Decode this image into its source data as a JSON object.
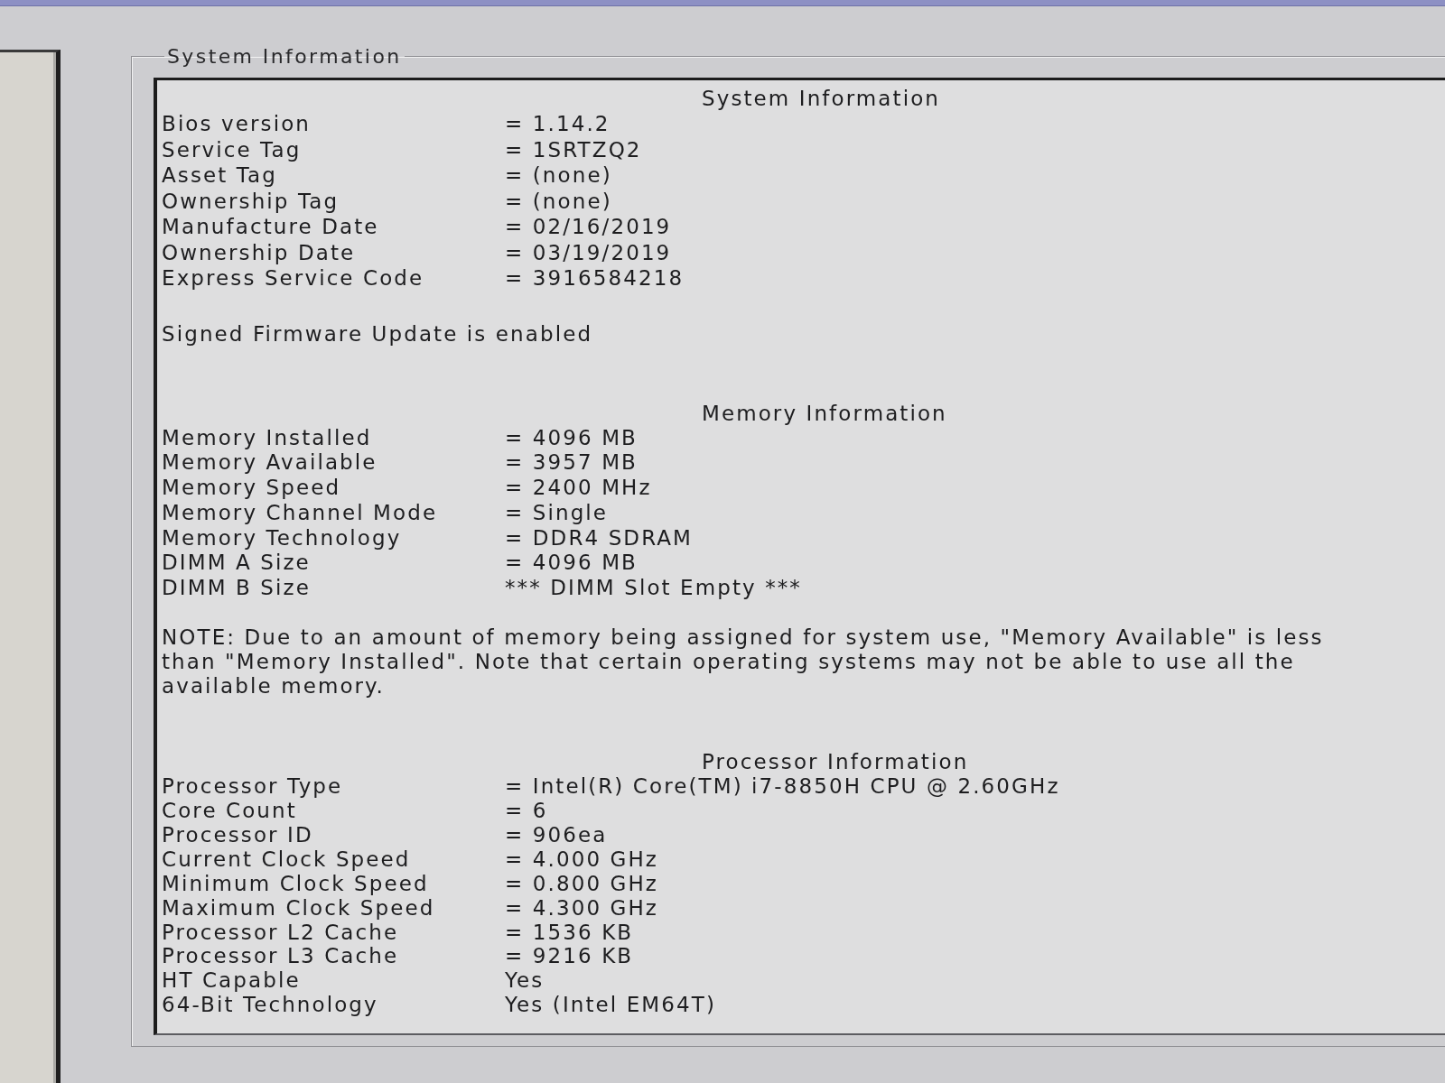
{
  "group_box": {
    "legend": "System Information"
  },
  "sections": [
    {
      "title": "System Information",
      "rows": [
        {
          "label": "Bios version",
          "value": "= 1.14.2"
        },
        {
          "label": "Service Tag",
          "value": "= 1SRTZQ2"
        },
        {
          "label": "Asset Tag",
          "value": "= (none)"
        },
        {
          "label": "Ownership Tag",
          "value": "= (none)"
        },
        {
          "label": "Manufacture Date",
          "value": "= 02/16/2019"
        },
        {
          "label": "Ownership Date",
          "value": "= 03/19/2019"
        },
        {
          "label": "Express Service Code",
          "value": "= 3916584218"
        }
      ],
      "notes": [
        "Signed Firmware Update is enabled"
      ]
    },
    {
      "title": "Memory Information",
      "rows": [
        {
          "label": "Memory Installed",
          "value": "= 4096 MB"
        },
        {
          "label": "Memory Available",
          "value": "= 3957 MB"
        },
        {
          "label": "Memory Speed",
          "value": "= 2400 MHz"
        },
        {
          "label": "Memory Channel Mode",
          "value": "= Single"
        },
        {
          "label": "Memory Technology",
          "value": "= DDR4 SDRAM"
        },
        {
          "label": "DIMM A Size",
          "value": "= 4096 MB"
        },
        {
          "label": "DIMM B Size",
          "value": "*** DIMM Slot Empty ***"
        }
      ],
      "notes": [
        "NOTE: Due to an amount of memory being assigned for system use, \"Memory Available\" is less than \"Memory Installed\". Note that certain operating systems may not be able to use all the available memory."
      ]
    },
    {
      "title": "Processor Information",
      "rows": [
        {
          "label": "Processor Type",
          "value": "= Intel(R) Core(TM) i7-8850H CPU @ 2.60GHz"
        },
        {
          "label": "Core Count",
          "value": "= 6"
        },
        {
          "label": "Processor ID",
          "value": "= 906ea"
        },
        {
          "label": "Current Clock Speed",
          "value": "= 4.000 GHz"
        },
        {
          "label": "Minimum Clock Speed",
          "value": "= 0.800 GHz"
        },
        {
          "label": "Maximum Clock Speed",
          "value": "= 4.300 GHz"
        },
        {
          "label": "Processor L2 Cache",
          "value": "= 1536 KB"
        },
        {
          "label": "Processor L3 Cache",
          "value": "= 9216 KB"
        },
        {
          "label": "HT Capable",
          "value": "Yes"
        },
        {
          "label": "64-Bit Technology",
          "value": "Yes (Intel EM64T)"
        }
      ]
    }
  ]
}
